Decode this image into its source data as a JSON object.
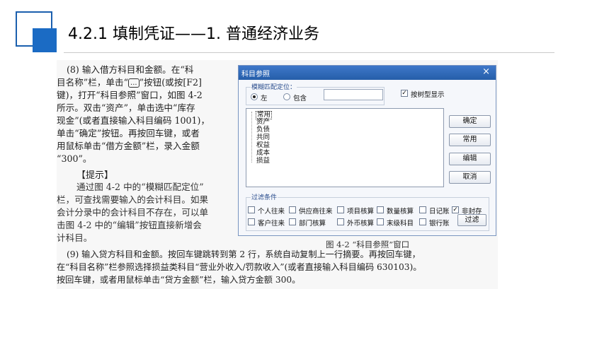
{
  "slide": {
    "title": "4.2.1  填制凭证——1. 普通经济业务"
  },
  "doc": {
    "para8_lines": [
      "(8) 输入借方科目和金额。在“科",
      "目名称”栏，单击“",
      "”按钮(或按[F2]",
      "键)，打开“科目参照”窗口，如图 4-2",
      "所示。双击“资产”，单击选中“库存",
      "现金”(或者直接输入科目编码 1001)，",
      "单击“确定”按钮。再按回车键，或者",
      "用鼠标单击“借方金额”栏，录入金额",
      "“300”。"
    ],
    "ellipsis_button": "...",
    "hint_title": "【提示】",
    "hint_lines": [
      "通过图 4-2 中的“模糊匹配定位”",
      "栏，可查找需要输入的会计科目。如果",
      "会计分录中的会计科目不存在，可以单",
      "击图 4-2 中的“编辑”按钮直接新增会",
      "计科目。"
    ],
    "caption": "图 4-2  “科目参照”窗口",
    "para9_lines": [
      "(9) 输入贷方科目和金额。按回车键跳转到第 2 行，系统自动复制上一行摘要。再按回车键，",
      "在“科目名称”栏参照选择损益类科目“营业外收入/罚款收入”(或者直接输入科目编码 630103)。",
      "按回车键，或者用鼠标单击“贷方金额”栏，输入贷方金额 300。"
    ]
  },
  "dialog": {
    "title": "科目参照",
    "close_icon": "×",
    "fuzzy_label": "模糊匹配定位：",
    "radio_left": "左",
    "radio_contains": "包含",
    "fuzzy_value": "",
    "tree_checkbox": "按树型显示",
    "tree_checked": true,
    "tree_items": [
      "常用",
      "资产",
      "负债",
      "共同",
      "权益",
      "成本",
      "损益"
    ],
    "buttons": [
      "确定",
      "常用",
      "编辑",
      "取消"
    ],
    "filter_label": "过滤条件",
    "filters_row1": [
      {
        "label": "个人往来",
        "checked": false
      },
      {
        "label": "供应商往来",
        "checked": false
      },
      {
        "label": "项目核算",
        "checked": false
      },
      {
        "label": "数量核算",
        "checked": false
      },
      {
        "label": "日记账",
        "checked": false
      },
      {
        "label": "非封存",
        "checked": true
      }
    ],
    "filters_row2": [
      {
        "label": "客户往来",
        "checked": false
      },
      {
        "label": "部门核算",
        "checked": false
      },
      {
        "label": "外币核算",
        "checked": false
      },
      {
        "label": "末级科目",
        "checked": false
      },
      {
        "label": "银行账",
        "checked": false
      }
    ],
    "filter_button": "过滤"
  },
  "colors": {
    "accent_blue": "#1b6bc4",
    "titlebar": "#255ea9",
    "doc_bg": "#f7f7f7"
  }
}
